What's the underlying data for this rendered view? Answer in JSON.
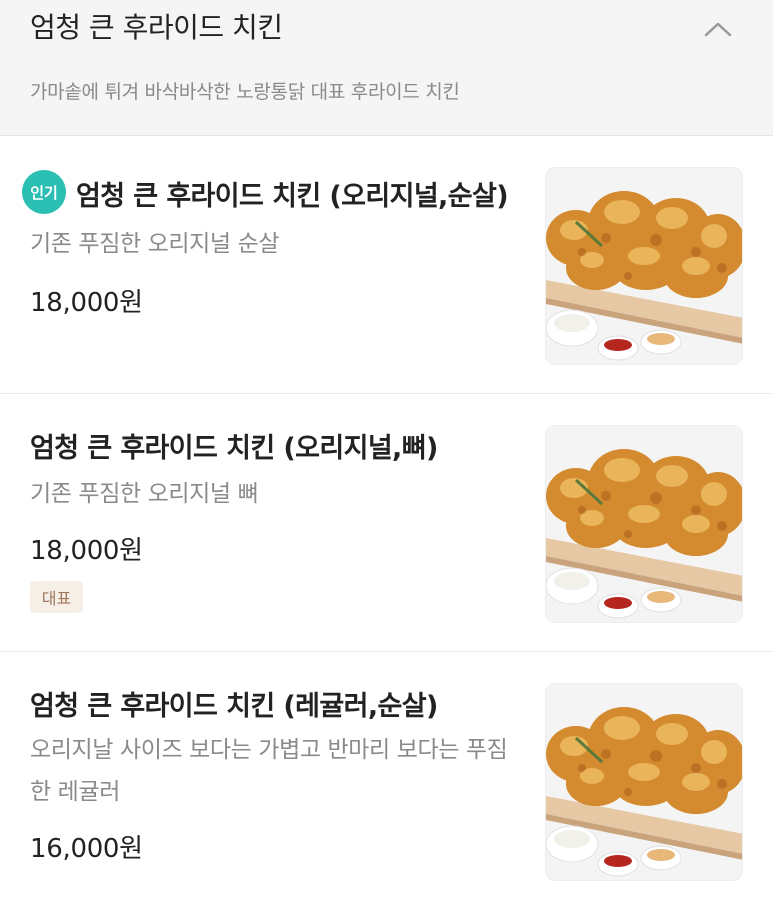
{
  "category": {
    "title": "엄청 큰 후라이드 치킨",
    "description": "가마솥에 튀겨 바삭바삭한 노랑통닭 대표 후라이드 치킨",
    "collapse_icon": "chevron-up-icon"
  },
  "items": [
    {
      "badge": "인기",
      "name": "엄청 큰 후라이드 치킨 (오리지널,순살)",
      "description": "기존 푸짐한 오리지널 순살",
      "price": "18,000원",
      "image": "fried-chicken-photo"
    },
    {
      "name": "엄청 큰 후라이드 치킨 (오리지널,뼈)",
      "description": "기존 푸짐한 오리지널 뼈",
      "price": "18,000원",
      "tag": "대표",
      "image": "fried-chicken-photo"
    },
    {
      "name": "엄청 큰 후라이드 치킨 (레귤러,순살)",
      "description": "오리지날 사이즈 보다는 가볍고 반마리 보다는 푸짐한 레귤러",
      "price": "16,000원",
      "image": "fried-chicken-photo"
    }
  ],
  "colors": {
    "popular_badge": "#2bbfb3",
    "rep_tag_bg": "#f6efe8",
    "rep_tag_text": "#a0775a"
  }
}
